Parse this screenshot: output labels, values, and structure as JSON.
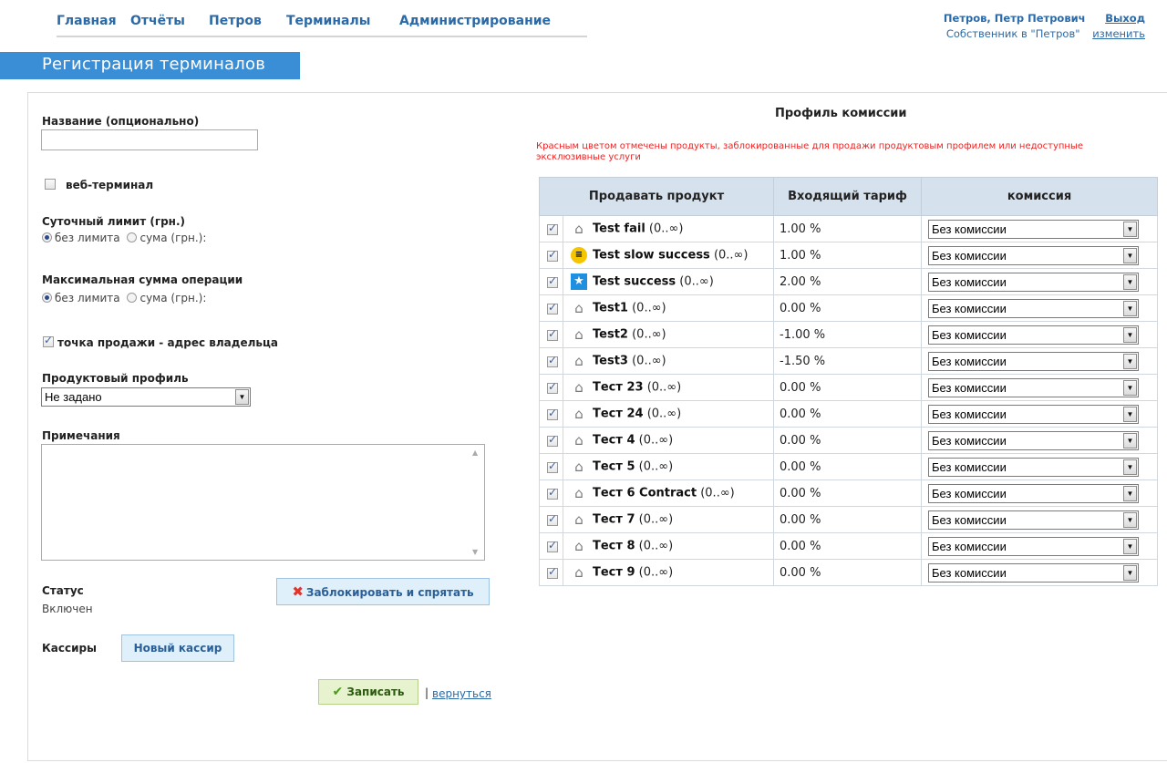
{
  "nav": {
    "items": [
      "Главная",
      "Отчёты",
      "Петров",
      "Терминалы",
      "Администрирование"
    ]
  },
  "user": {
    "name": "Петров, Петр Петрович",
    "logout": "Выход",
    "role": "Собственник в \"Петров\"",
    "change": "изменить"
  },
  "page": {
    "title": "Регистрация терминалов"
  },
  "form": {
    "name_label": "Название (опционально)",
    "name_value": "",
    "web_terminal_label": "веб-терминал",
    "web_terminal_checked": false,
    "daily_limit_label": "Суточный лимит (грн.)",
    "daily_no_limit": "без лимита",
    "daily_sum": "сума (грн.):",
    "max_sum_label": "Максимальная сумма операции",
    "max_no_limit": "без лимита",
    "max_sum": "сума (грн.):",
    "sale_point_label": "точка продажи - адрес владельца",
    "sale_point_checked": true,
    "product_profile_label": "Продуктовый профиль",
    "product_profile_value": "Не задано",
    "notes_label": "Примечания",
    "notes_value": "",
    "status_label": "Статус",
    "status_value": "Включен",
    "block_button": "Заблокировать и спрятать",
    "cashiers_label": "Кассиры",
    "new_cashier_button": "Новый кассир",
    "save_button": "Записать",
    "separator": "|",
    "back_link": "вернуться"
  },
  "profile": {
    "title": "Профиль комиссии",
    "warning": "Красным цветом отмечены продукты, заблокированные для продажи продуктовым профилем или недоступные эксклюзивные услуги",
    "headers": [
      "Продавать продукт",
      "Входящий тариф",
      "комиссия"
    ],
    "rows": [
      {
        "icon": "house-icon",
        "name": "Test fail",
        "range": "(0..∞)",
        "tariff": "1.00 %",
        "commission": "Без комиссии"
      },
      {
        "icon": "beeline-icon",
        "name": "Test slow success",
        "range": "(0..∞)",
        "tariff": "1.00 %",
        "commission": "Без комиссии"
      },
      {
        "icon": "star-icon",
        "name": "Test success",
        "range": "(0..∞)",
        "tariff": "2.00 %",
        "commission": "Без комиссии"
      },
      {
        "icon": "house-icon",
        "name": "Test1",
        "range": "(0..∞)",
        "tariff": "0.00 %",
        "commission": "Без комиссии"
      },
      {
        "icon": "house-icon",
        "name": "Test2",
        "range": "(0..∞)",
        "tariff": "-1.00 %",
        "commission": "Без комиссии"
      },
      {
        "icon": "house-icon",
        "name": "Test3",
        "range": "(0..∞)",
        "tariff": "-1.50 %",
        "commission": "Без комиссии"
      },
      {
        "icon": "house-icon",
        "name": "Тест 23",
        "range": "(0..∞)",
        "tariff": "0.00 %",
        "commission": "Без комиссии"
      },
      {
        "icon": "house-icon",
        "name": "Тест 24",
        "range": "(0..∞)",
        "tariff": "0.00 %",
        "commission": "Без комиссии"
      },
      {
        "icon": "house-icon",
        "name": "Тест 4",
        "range": "(0..∞)",
        "tariff": "0.00 %",
        "commission": "Без комиссии"
      },
      {
        "icon": "house-icon",
        "name": "Тест 5",
        "range": "(0..∞)",
        "tariff": "0.00 %",
        "commission": "Без комиссии"
      },
      {
        "icon": "house-icon",
        "name": "Тест 6 Contract",
        "range": "(0..∞)",
        "tariff": "0.00 %",
        "commission": "Без комиссии"
      },
      {
        "icon": "house-icon",
        "name": "Тест 7",
        "range": "(0..∞)",
        "tariff": "0.00 %",
        "commission": "Без комиссии"
      },
      {
        "icon": "house-icon",
        "name": "Тест 8",
        "range": "(0..∞)",
        "tariff": "0.00 %",
        "commission": "Без комиссии"
      },
      {
        "icon": "house-icon",
        "name": "Тест 9",
        "range": "(0..∞)",
        "tariff": "0.00 %",
        "commission": "Без комиссии"
      }
    ]
  }
}
